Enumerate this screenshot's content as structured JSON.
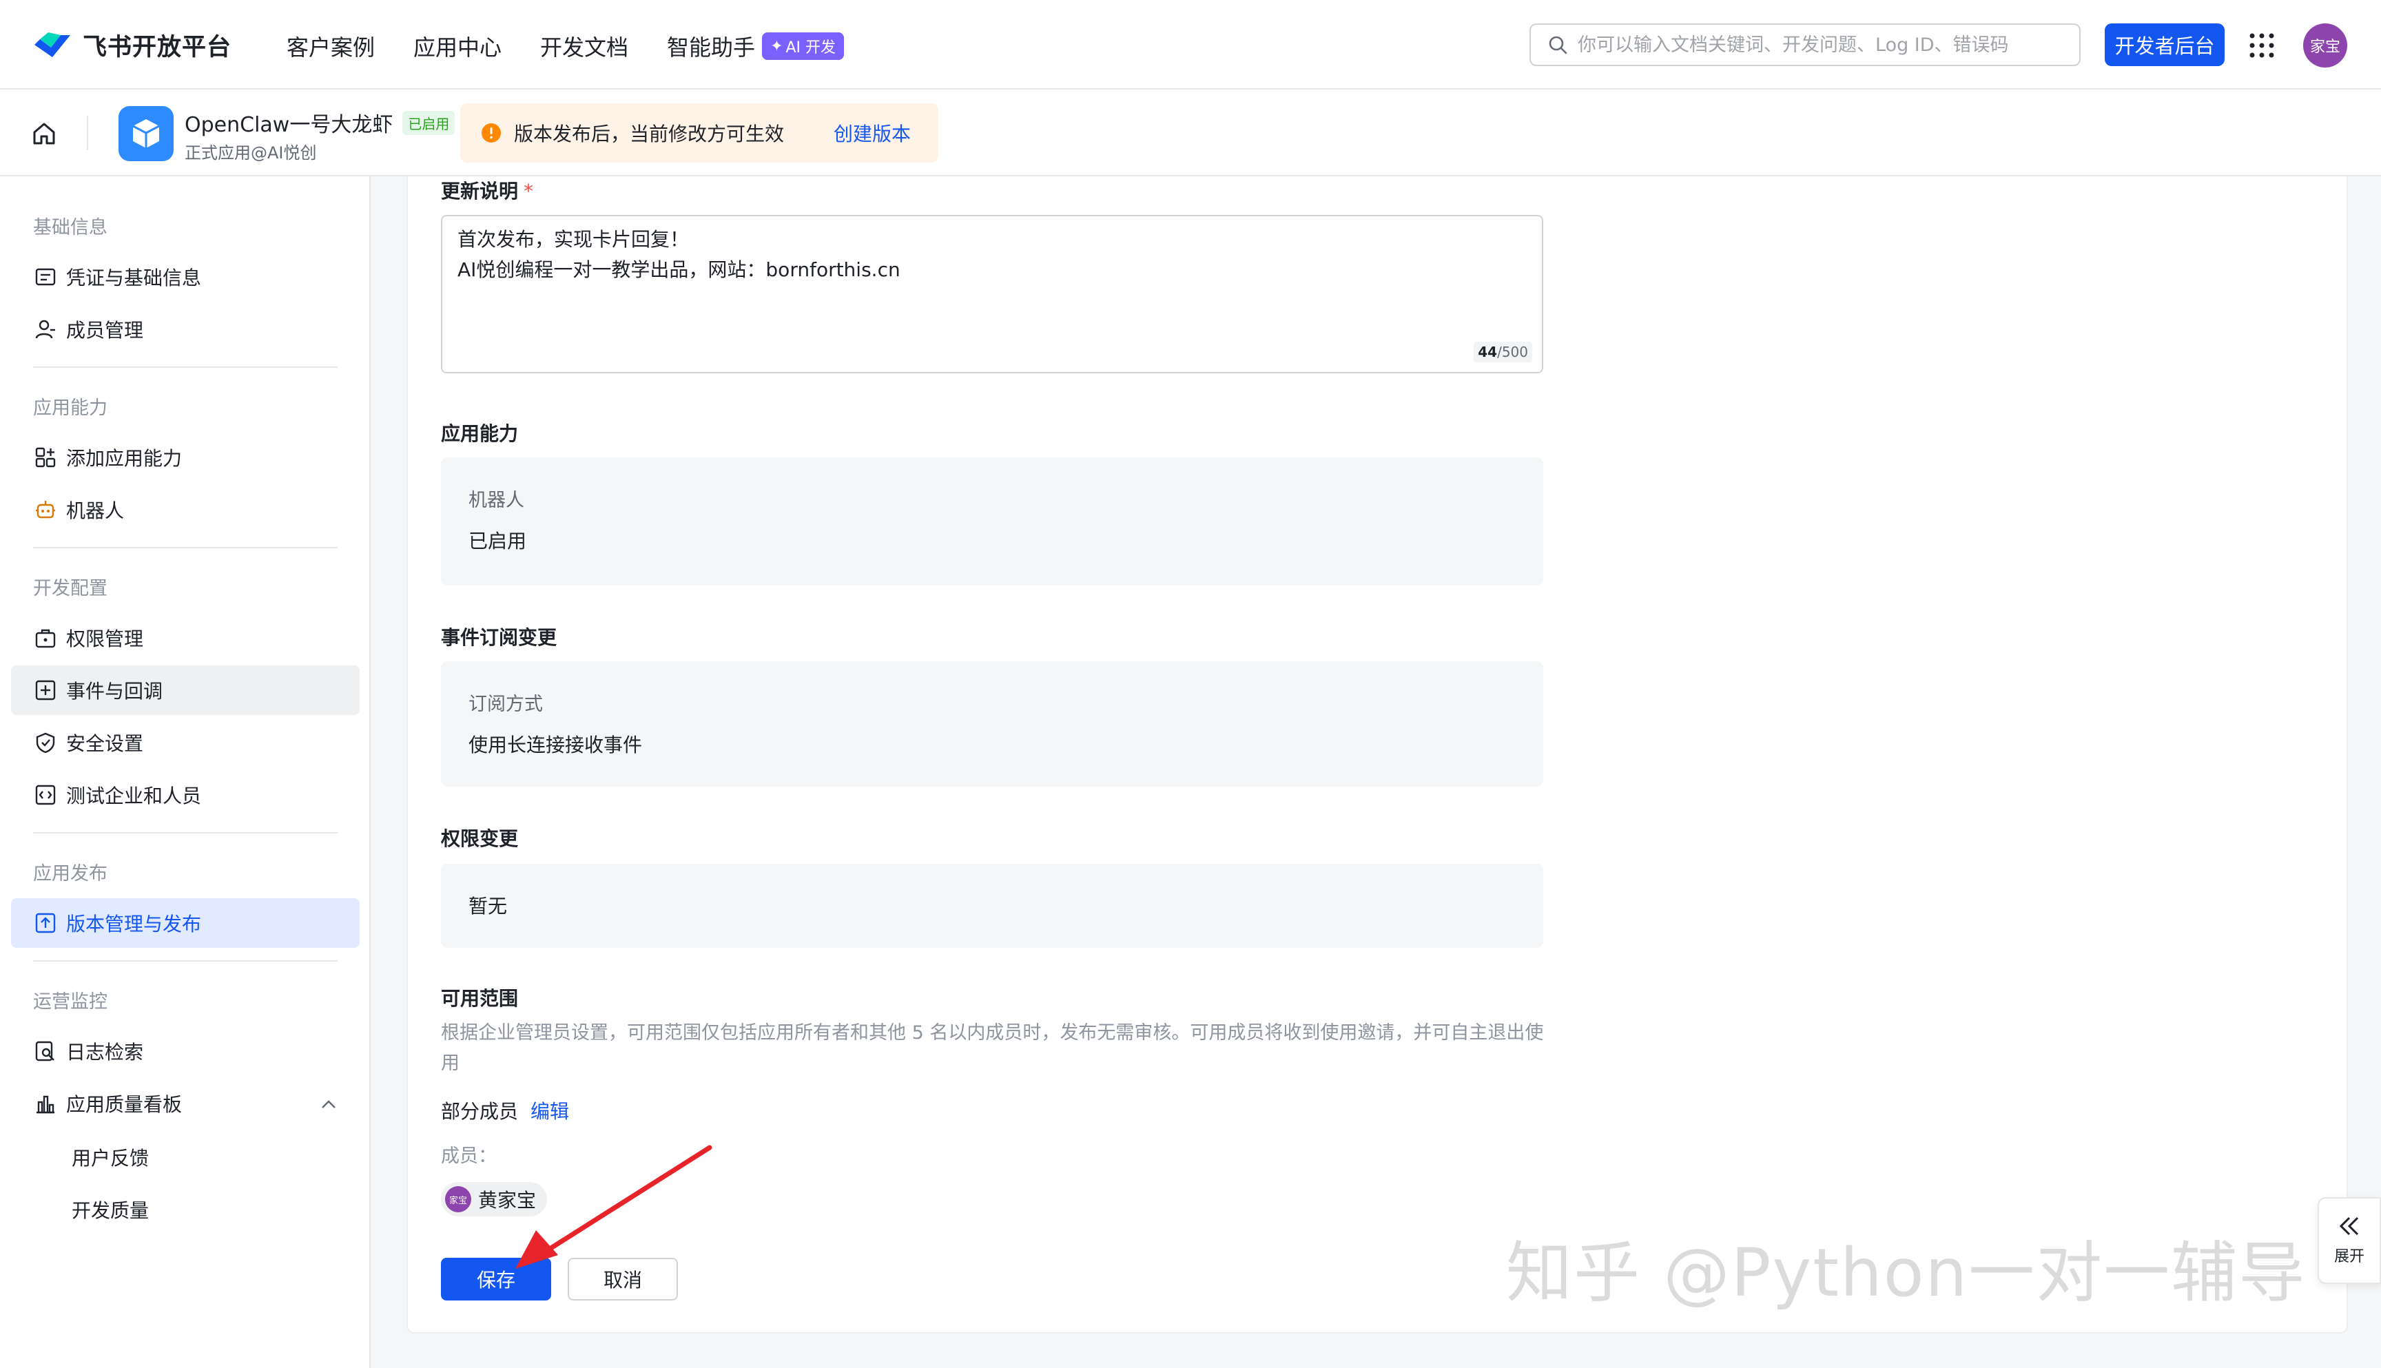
{
  "topnav": {
    "brand": "飞书开放平台",
    "nav": [
      "客户案例",
      "应用中心",
      "开发文档",
      "智能助手"
    ],
    "ai_badge": "AI 开发",
    "search_placeholder": "你可以输入文档关键词、开发问题、Log ID、错误码",
    "dev_console": "开发者后台",
    "avatar": "家宝"
  },
  "app": {
    "name": "OpenClaw一号大龙虾",
    "status": "已启用",
    "subtitle": "正式应用@AI悦创",
    "notice": "版本发布后，当前修改方可生效",
    "notice_link": "创建版本"
  },
  "sidebar": {
    "groups": {
      "basic": "基础信息",
      "capability": "应用能力",
      "dev": "开发配置",
      "publish": "应用发布",
      "ops": "运营监控"
    },
    "items": {
      "credentials": "凭证与基础信息",
      "members": "成员管理",
      "add_capability": "添加应用能力",
      "bot": "机器人",
      "permissions": "权限管理",
      "events": "事件与回调",
      "security": "安全设置",
      "test": "测试企业和人员",
      "versions": "版本管理与发布",
      "logs": "日志检索",
      "quality": "应用质量看板",
      "feedback": "用户反馈",
      "dev_quality": "开发质量"
    }
  },
  "form": {
    "update_label": "更新说明",
    "required_mark": "*",
    "update_line1": "首次发布，实现卡片回复！",
    "update_line2": "AI悦创编程一对一教学出品，网站：bornforthis.cn",
    "counter_current": "44",
    "counter_max": "/500",
    "capability_label": "应用能力",
    "capability_key": "机器人",
    "capability_val": "已启用",
    "event_label": "事件订阅变更",
    "event_key": "订阅方式",
    "event_val": "使用长连接接收事件",
    "perm_label": "权限变更",
    "perm_val": "暂无",
    "scope_label": "可用范围",
    "scope_desc": "根据企业管理员设置，可用范围仅包括应用所有者和其他 5 名以内成员时，发布无需审核。可用成员将收到使用邀请，并可自主退出使用",
    "scope_type": "部分成员",
    "scope_edit": "编辑",
    "members_label": "成员：",
    "member_avatar": "家宝",
    "member_name": "黄家宝",
    "save": "保存",
    "cancel": "取消"
  },
  "watermark": "知乎 @Python一对一辅导",
  "expand": "展开",
  "colors": {
    "primary": "#1456f0",
    "danger": "#f54a45",
    "notice_bg": "#fff3e8",
    "active_bg": "#e1eaff",
    "arrow": "#e8242b"
  }
}
